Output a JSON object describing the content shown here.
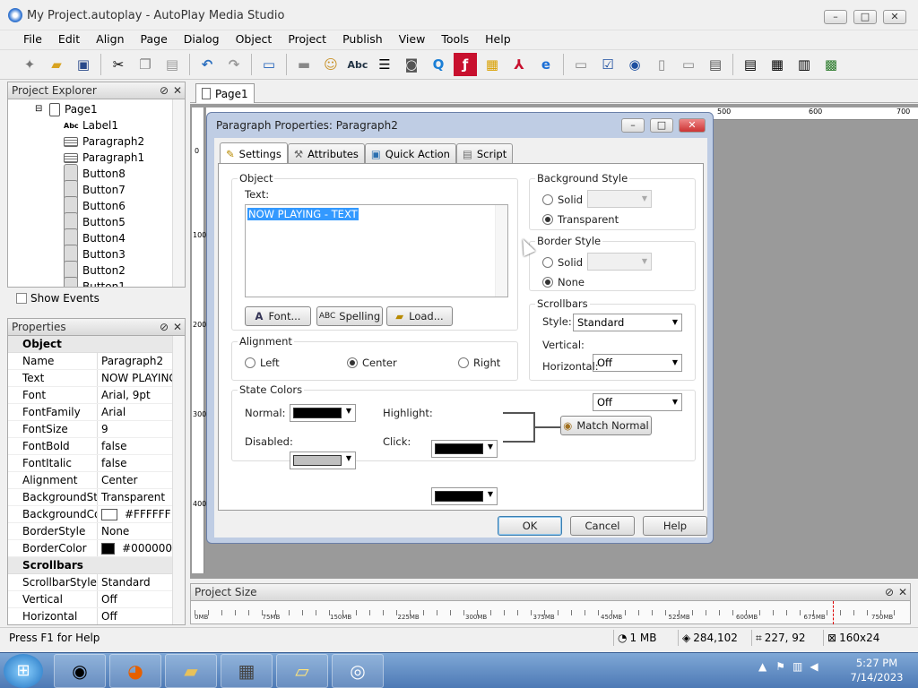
{
  "window": {
    "title": "My Project.autoplay - AutoPlay Media Studio"
  },
  "menu": [
    "File",
    "Edit",
    "Align",
    "Page",
    "Dialog",
    "Object",
    "Project",
    "Publish",
    "View",
    "Tools",
    "Help"
  ],
  "page_tab": "Page1",
  "explorer": {
    "title": "Project Explorer",
    "items": [
      {
        "label": "Page1",
        "type": "page"
      },
      {
        "label": "Label1",
        "type": "label"
      },
      {
        "label": "Paragraph2",
        "type": "para"
      },
      {
        "label": "Paragraph1",
        "type": "para"
      },
      {
        "label": "Button8",
        "type": "btn"
      },
      {
        "label": "Button7",
        "type": "btn"
      },
      {
        "label": "Button6",
        "type": "btn"
      },
      {
        "label": "Button5",
        "type": "btn"
      },
      {
        "label": "Button4",
        "type": "btn"
      },
      {
        "label": "Button3",
        "type": "btn"
      },
      {
        "label": "Button2",
        "type": "btn"
      },
      {
        "label": "Button1",
        "type": "btn"
      }
    ],
    "show_events": "Show Events"
  },
  "properties": {
    "title": "Properties",
    "cat_object": "Object",
    "rows": [
      {
        "k": "Name",
        "v": "Paragraph2"
      },
      {
        "k": "Text",
        "v": "NOW PLAYING"
      },
      {
        "k": "Font",
        "v": "Arial, 9pt"
      },
      {
        "k": "FontFamily",
        "v": "Arial"
      },
      {
        "k": "FontSize",
        "v": "9"
      },
      {
        "k": "FontBold",
        "v": "false"
      },
      {
        "k": "FontItalic",
        "v": "false"
      },
      {
        "k": "Alignment",
        "v": "Center"
      },
      {
        "k": "BackgroundStyle",
        "v": "Transparent"
      },
      {
        "k": "BackgroundColor",
        "v": "#FFFFFF",
        "swatch": "#FFFFFF"
      },
      {
        "k": "BorderStyle",
        "v": "None"
      },
      {
        "k": "BorderColor",
        "v": "#000000",
        "swatch": "#000000"
      }
    ],
    "cat_scroll": "Scrollbars",
    "rows2": [
      {
        "k": "ScrollbarStyle",
        "v": "Standard"
      },
      {
        "k": "Vertical",
        "v": "Off"
      },
      {
        "k": "Horizontal",
        "v": "Off"
      }
    ]
  },
  "ruler": {
    "marks": [
      "500",
      "600",
      "700"
    ],
    "vmarks": [
      "0",
      "100",
      "200",
      "300",
      "400"
    ]
  },
  "dialog": {
    "title": "Paragraph Properties: Paragraph2",
    "tabs": [
      "Settings",
      "Attributes",
      "Quick Action",
      "Script"
    ],
    "object_group": "Object",
    "text_label": "Text:",
    "text_value": "NOW PLAYING - TEXT",
    "font_btn": "Font...",
    "spelling_btn": "Spelling",
    "load_btn": "Load...",
    "alignment_group": "Alignment",
    "align_left": "Left",
    "align_center": "Center",
    "align_right": "Right",
    "bg_group": "Background Style",
    "bg_solid": "Solid",
    "bg_transparent": "Transparent",
    "border_group": "Border Style",
    "border_solid": "Solid",
    "border_none": "None",
    "scroll_group": "Scrollbars",
    "style_label": "Style:",
    "style_value": "Standard",
    "vertical_label": "Vertical:",
    "vertical_value": "Off",
    "horizontal_label": "Horizontal:",
    "horizontal_value": "Off",
    "state_group": "State Colors",
    "normal_label": "Normal:",
    "highlight_label": "Highlight:",
    "disabled_label": "Disabled:",
    "click_label": "Click:",
    "match_btn": "Match Normal",
    "ok": "OK",
    "cancel": "Cancel",
    "help": "Help",
    "colors": {
      "normal": "#000000",
      "highlight": "#000000",
      "disabled": "#c0c0c0",
      "click": "#000000"
    }
  },
  "project_size": {
    "title": "Project Size",
    "ticks": [
      "0MB",
      "75MB",
      "150MB",
      "225MB",
      "300MB",
      "375MB",
      "450MB",
      "525MB",
      "600MB",
      "675MB",
      "750MB"
    ]
  },
  "status": {
    "help": "Press F1 for Help",
    "size": "1 MB",
    "count": "284,102",
    "pos": "227, 92",
    "dim": "160x24"
  },
  "taskbar": {
    "time": "5:27 PM",
    "date": "7/14/2023"
  },
  "accent": "#3399ff"
}
